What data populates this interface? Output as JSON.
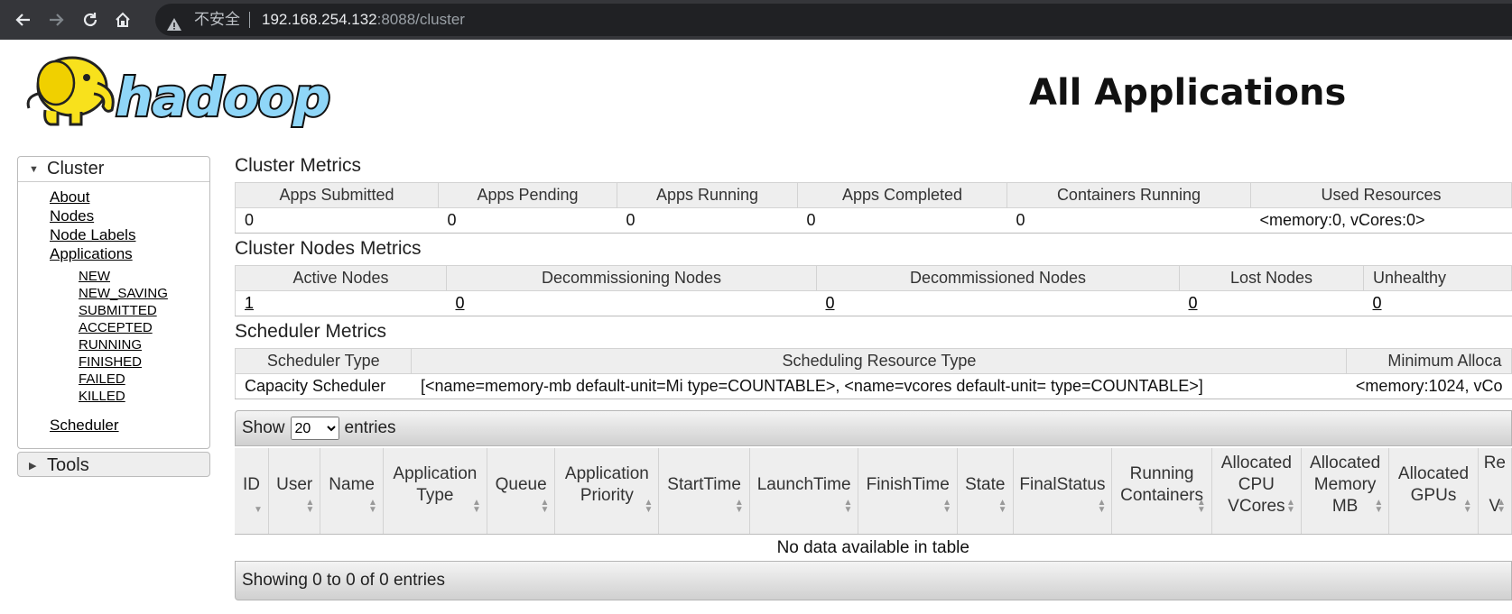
{
  "browser": {
    "security_label": "不安全",
    "url_host": "192.168.254.132",
    "url_path": ":8088/cluster"
  },
  "header": {
    "logo_text": "hadoop",
    "title": "All Applications"
  },
  "sidebar": {
    "cluster_label": "Cluster",
    "links": [
      "About",
      "Nodes",
      "Node Labels",
      "Applications"
    ],
    "app_states": [
      "NEW",
      "NEW_SAVING",
      "SUBMITTED",
      "ACCEPTED",
      "RUNNING",
      "FINISHED",
      "FAILED",
      "KILLED"
    ],
    "scheduler_label": "Scheduler",
    "tools_label": "Tools"
  },
  "cluster_metrics": {
    "title": "Cluster Metrics",
    "headers": [
      "Apps Submitted",
      "Apps Pending",
      "Apps Running",
      "Apps Completed",
      "Containers Running",
      "Used Resources"
    ],
    "values": [
      "0",
      "0",
      "0",
      "0",
      "0",
      "<memory:0, vCores:0>"
    ]
  },
  "node_metrics": {
    "title": "Cluster Nodes Metrics",
    "headers": [
      "Active Nodes",
      "Decommissioning Nodes",
      "Decommissioned Nodes",
      "Lost Nodes",
      "Unhealthy"
    ],
    "values": [
      "1",
      "0",
      "0",
      "0",
      "0"
    ]
  },
  "scheduler_metrics": {
    "title": "Scheduler Metrics",
    "headers": [
      "Scheduler Type",
      "Scheduling Resource Type",
      "Minimum Alloca"
    ],
    "values": [
      "Capacity Scheduler",
      "[<name=memory-mb default-unit=Mi type=COUNTABLE>, <name=vcores default-unit= type=COUNTABLE>]",
      "<memory:1024, vCo"
    ]
  },
  "apps_table": {
    "show_label": "Show",
    "page_size": "20",
    "entries_label": "entries",
    "columns": [
      [
        "ID"
      ],
      [
        "User"
      ],
      [
        "Name"
      ],
      [
        "Application",
        "Type"
      ],
      [
        "Queue"
      ],
      [
        "Application",
        "Priority"
      ],
      [
        "StartTime"
      ],
      [
        "LaunchTime"
      ],
      [
        "FinishTime"
      ],
      [
        "State"
      ],
      [
        "FinalStatus"
      ],
      [
        "Running",
        "Containers"
      ],
      [
        "Allocated",
        "CPU",
        "VCores"
      ],
      [
        "Allocated",
        "Memory",
        "MB"
      ],
      [
        "Allocated",
        "GPUs"
      ],
      [
        "Re",
        "",
        "V"
      ]
    ],
    "empty_message": "No data available in table",
    "footer": "Showing 0 to 0 of 0 entries"
  }
}
